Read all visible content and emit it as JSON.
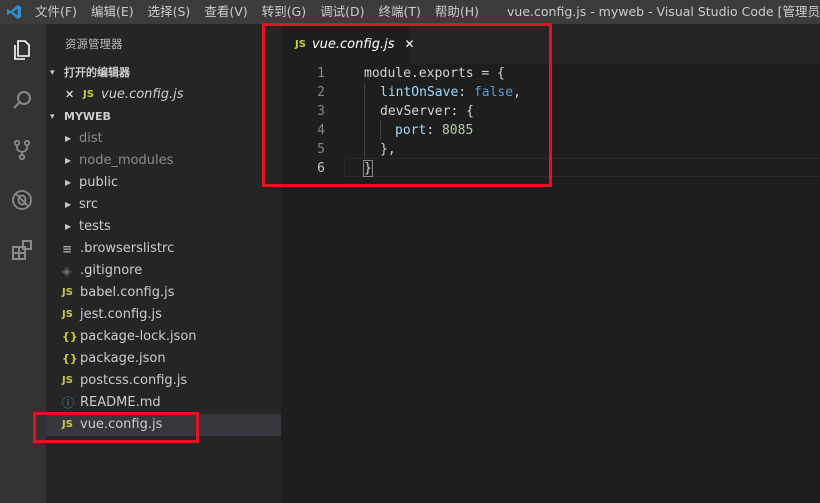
{
  "titlebar": {
    "menu": [
      "文件(F)",
      "编辑(E)",
      "选择(S)",
      "查看(V)",
      "转到(G)",
      "调试(D)",
      "终端(T)",
      "帮助(H)"
    ],
    "window_title": "vue.config.js - myweb - Visual Studio Code [管理员"
  },
  "activity_bar": [
    "files-icon",
    "search-icon",
    "source-control-icon",
    "debug-icon",
    "extensions-icon"
  ],
  "sidebar": {
    "header": "资源管理器",
    "open_editors": {
      "title": "打开的编辑器",
      "items": [
        {
          "icon": "JS",
          "close": "✕",
          "name": "vue.config.js"
        }
      ]
    },
    "project": {
      "title": "MYWEB",
      "folders": [
        "dist",
        "node_modules",
        "public",
        "src",
        "tests"
      ],
      "files": [
        {
          "icon": "≡",
          "name": ".browserslistrc"
        },
        {
          "icon": "◈",
          "name": ".gitignore"
        },
        {
          "icon": "JS",
          "name": "babel.config.js"
        },
        {
          "icon": "JS",
          "name": "jest.config.js"
        },
        {
          "icon": "{}",
          "name": "package-lock.json"
        },
        {
          "icon": "{}",
          "name": "package.json"
        },
        {
          "icon": "JS",
          "name": "postcss.config.js"
        },
        {
          "icon": "ⓘ",
          "name": "README.md"
        },
        {
          "icon": "JS",
          "name": "vue.config.js"
        }
      ]
    }
  },
  "editor": {
    "tab": {
      "icon": "JS",
      "name": "vue.config.js",
      "close": "✕"
    },
    "line_numbers": [
      "1",
      "2",
      "3",
      "4",
      "5",
      "6"
    ],
    "code": {
      "l1": {
        "a": "module.exports = {"
      },
      "l2": {
        "prop": "lintOnSave",
        "colon": ": ",
        "val": "false",
        "end": ","
      },
      "l3": {
        "a": "devServer: {"
      },
      "l4": {
        "prop": "port",
        "colon": ": ",
        "val": "8085"
      },
      "l5": {
        "a": "},"
      },
      "l6": {
        "a": "}"
      }
    }
  },
  "colors": {
    "accent_red": "#e81123",
    "js_icon": "#cbcb41",
    "keyword": "#569cd6",
    "property": "#9cdcfe",
    "number": "#b5cea8"
  }
}
